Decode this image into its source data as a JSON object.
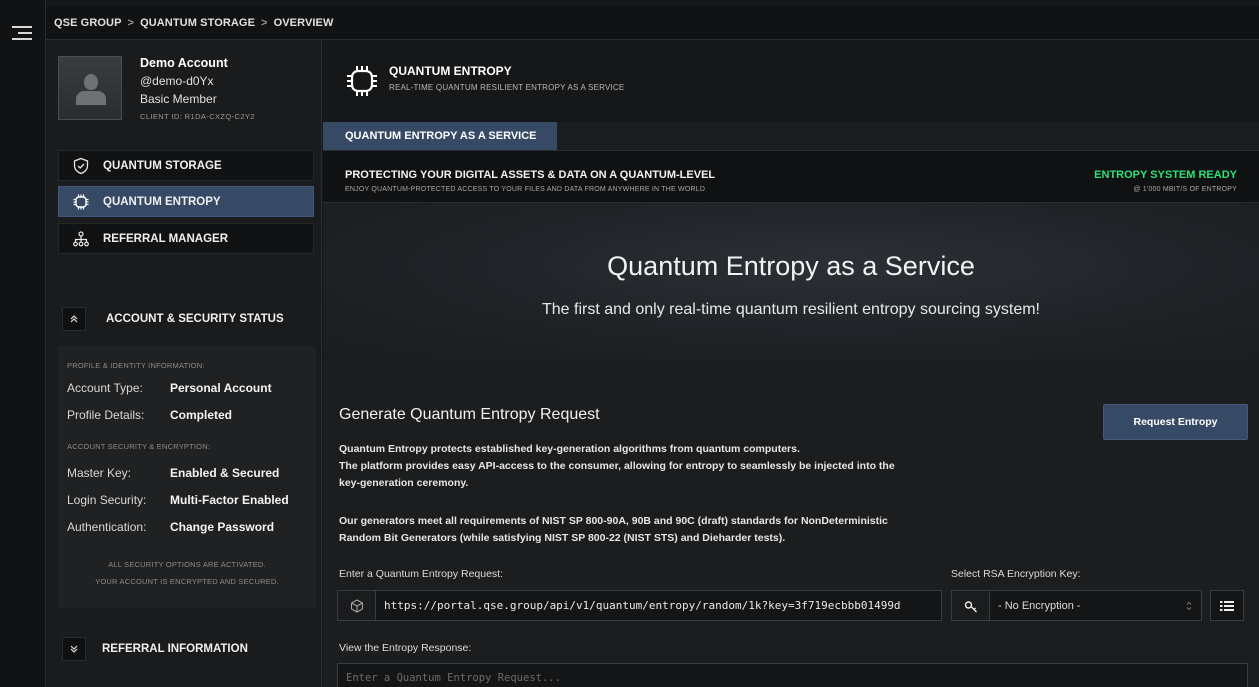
{
  "breadcrumb": [
    "QSE GROUP",
    "QUANTUM STORAGE",
    "OVERVIEW"
  ],
  "breadcrumb_sep": ">",
  "profile": {
    "name": "Demo Account",
    "handle": "@demo-d0Yx",
    "tier": "Basic Member",
    "client_id": "CLIENT ID: R1DA-CXZQ-C2Y2"
  },
  "nav": [
    {
      "label": "QUANTUM STORAGE",
      "icon": "shield-icon",
      "active": false
    },
    {
      "label": "QUANTUM ENTROPY",
      "icon": "chip-icon",
      "active": true
    },
    {
      "label": "REFERRAL MANAGER",
      "icon": "network-icon",
      "active": false
    }
  ],
  "security_section": {
    "title": "ACCOUNT & SECURITY STATUS",
    "identity_caption": "PROFILE & IDENTITY INFORMATION:",
    "account_type_key": "Account Type:",
    "account_type_value": "Personal Account",
    "profile_details_key": "Profile Details:",
    "profile_details_value": "Completed",
    "security_caption": "ACCOUNT SECURITY & ENCRYPTION:",
    "master_key_key": "Master Key:",
    "master_key_value": "Enabled & Secured",
    "login_security_key": "Login Security:",
    "login_security_value": "Multi-Factor Enabled",
    "authentication_key": "Authentication:",
    "authentication_value": "Change Password",
    "note_line1": "ALL SECURITY OPTIONS ARE ACTIVATED.",
    "note_line2": "YOUR ACCOUNT IS ENCRYPTED AND SECURED."
  },
  "referral_section": {
    "title": "REFERRAL INFORMATION"
  },
  "page_header": {
    "title": "QUANTUM ENTROPY",
    "subtitle": "REAL-TIME QUANTUM RESILIENT ENTROPY AS A SERVICE"
  },
  "tab": {
    "label": "QUANTUM ENTROPY AS A SERVICE"
  },
  "status": {
    "headline": "PROTECTING YOUR DIGITAL ASSETS & DATA ON A QUANTUM-LEVEL",
    "subline": "ENJOY QUANTUM-PROTECTED ACCESS TO YOUR FILES AND DATA FROM ANYWHERE IN THE WORLD",
    "state": "ENTROPY SYSTEM READY",
    "rate": "@ 1'000 MBIT/S OF ENTROPY",
    "state_color": "#2ee07a"
  },
  "hero": {
    "title": "Quantum Entropy as a Service",
    "subtitle": "The first and only real-time quantum resilient entropy sourcing system!"
  },
  "request": {
    "title": "Generate Quantum Entropy Request",
    "button_label": "Request Entropy",
    "para1_line1": "Quantum Entropy protects established key-generation algorithms from quantum computers.",
    "para1_line2": "The platform provides easy API-access to the consumer, allowing for entropy to seamlessly be injected into the",
    "para1_line3": "key-generation ceremony.",
    "para2_line1": "Our generators meet all requirements of NIST SP 800-90A, 90B and 90C (draft) standards for NonDeterministic",
    "para2_line2": "Random Bit Generators (while satisfying NIST SP 800-22 (NIST STS) and Dieharder tests).",
    "input_label": "Enter a Quantum Entropy Request:",
    "input_value": "https://portal.qse.group/api/v1/quantum/entropy/random/1k?key=3f719ecbbb01499d",
    "rsa_label": "Select RSA Encryption Key:",
    "rsa_selected": "- No Encryption -",
    "response_label": "View the Entropy Response:",
    "response_placeholder": "Enter a Quantum Entropy Request..."
  },
  "colors": {
    "accent": "#364a66",
    "background": "#1c1d1e",
    "ready": "#2ee07a"
  }
}
